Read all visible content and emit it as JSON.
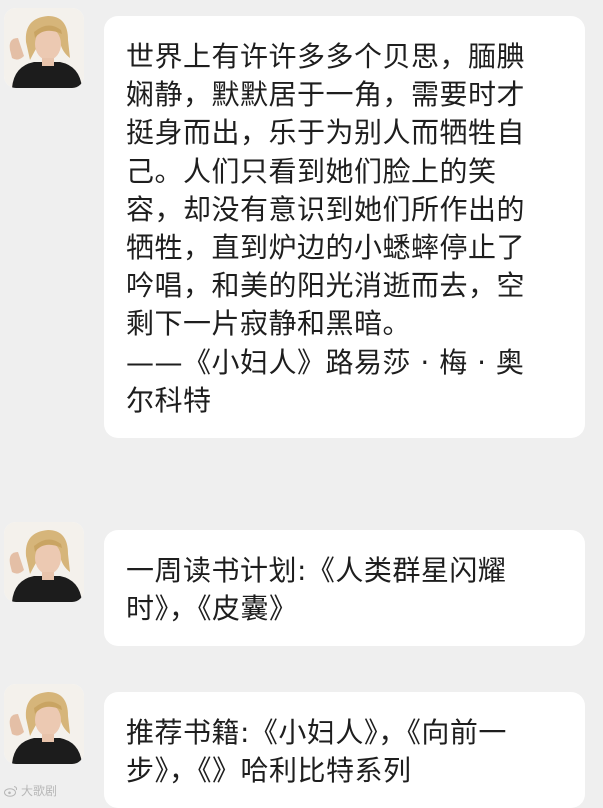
{
  "messages": [
    {
      "sender_avatar": "person-avatar",
      "text": "世界上有许许多多个贝思，腼腆\n娴静，默默居于一角，需要时才\n挺身而出，乐于为别人而牺牲自\n己。人们只看到她们脸上的笑\n容，却没有意识到她们所作出的\n牺牲，直到炉边的小蟋蟀停止了\n吟唱，和美的阳光消逝而去，空\n剩下一片寂静和黑暗。\n——《小妇人》路易莎 · 梅 · 奥\n尔科特"
    },
    {
      "sender_avatar": "person-avatar",
      "text": "一周读书计划:《人类群星闪耀\n时》，《皮囊》"
    },
    {
      "sender_avatar": "person-avatar",
      "text": "推荐书籍:《小妇人》，《向前一\n步》，《》哈利比特系列"
    }
  ],
  "watermark": {
    "icon": "weibo-icon",
    "text": "大歌剧"
  },
  "colors": {
    "background": "#efefef",
    "bubble": "#ffffff",
    "text": "#1e1e1e"
  }
}
